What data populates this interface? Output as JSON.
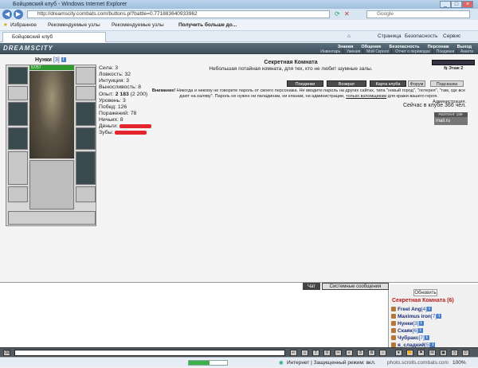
{
  "window": {
    "title": "Бойцовский клуб - Windows Internet Explorer"
  },
  "browser": {
    "url": "http://dreamscity.combats.com/buttons.pl?battle=0.771883640933962",
    "search_placeholder": "Google",
    "favorites_label": "Избранное",
    "fav_links": [
      "Рекомендуемые узлы",
      "Рекомендуемые узлы",
      "Получить больше до..."
    ],
    "tab_title": "Бойцовский клуб",
    "cmd_buttons": [
      "Страница",
      "Безопасность",
      "Сервис"
    ]
  },
  "game": {
    "logo": "DREAMSCITY",
    "top_nav": [
      "Знания",
      "Общение",
      "Безопасность",
      "Персонаж",
      "Выход"
    ],
    "sub_nav": [
      "Инвентарь",
      "Умения",
      "Мой Скролл",
      "Отчет о переводах",
      "Поединки",
      "Анкета"
    ]
  },
  "character": {
    "name": "Нунки",
    "level": "[3]",
    "hp": "57/57",
    "stats": [
      {
        "label": "Сила:",
        "value": "3"
      },
      {
        "label": "Ловкость:",
        "value": "32"
      },
      {
        "label": "Интуиция:",
        "value": "3"
      },
      {
        "label": "Выносливость:",
        "value": "8"
      }
    ],
    "exp_label": "Опыт:",
    "exp_value": "2 183",
    "exp_next": "(2 200)",
    "stats2": [
      {
        "label": "Уровень:",
        "value": "3"
      },
      {
        "label": "Побед:",
        "value": "126"
      },
      {
        "label": "Поражений:",
        "value": "78"
      },
      {
        "label": "Ничьих:",
        "value": "8"
      }
    ],
    "money_label": "Деньги:",
    "teeth_label": "Зубы:"
  },
  "room": {
    "title": "Секретная Комната",
    "description": "Небольшая потайная комната, для тех, кто не любит шумные залы.",
    "floor_label": "Этаж 2",
    "buttons": [
      "Поединки",
      "Возврат",
      "Карта клуба",
      "Форум",
      "Подсказка"
    ],
    "warning_bold": "Внимание!",
    "warning_text": "Никогда и никому не говорите пароль от своего персонажа. Не вводите пароль на других сайтах, типа \"новый город\", \"лотерея\", \"там, где все дают на халяву\". Пароль не нужен ни паладинам, ни кланам, ни администрации,",
    "warning_link": "только взломщикам",
    "warning_tail": "для кражи вашего героя.",
    "warning_sign": "Администрация.",
    "online": "Сейчас в клубе 366 чел.",
    "counter_top": "РЕЙТИНГ 199-199229",
    "counter_bottom": "mail.ru"
  },
  "chat": {
    "tabs": [
      "Чат",
      "Системные сообщения"
    ],
    "refresh_label": "Обновить",
    "room_label": "Секретная Комната (6)",
    "users": [
      {
        "name": "Freel Ang",
        "level": "[4]"
      },
      {
        "name": "Maximus iron",
        "level": "[7]"
      },
      {
        "name": "Нунки",
        "level": "[3]"
      },
      {
        "name": "Скаяк",
        "level": "[6]"
      },
      {
        "name": "Чубракс",
        "level": "[7]"
      },
      {
        "name": "я_сладкий",
        "level": "[5]"
      }
    ]
  },
  "status": {
    "zone": "Интернет | Защищенный режим: вкл.",
    "zoom": "100%",
    "progress_fraction": 0.55
  },
  "watermark": "photo.scrolls.combats.com"
}
